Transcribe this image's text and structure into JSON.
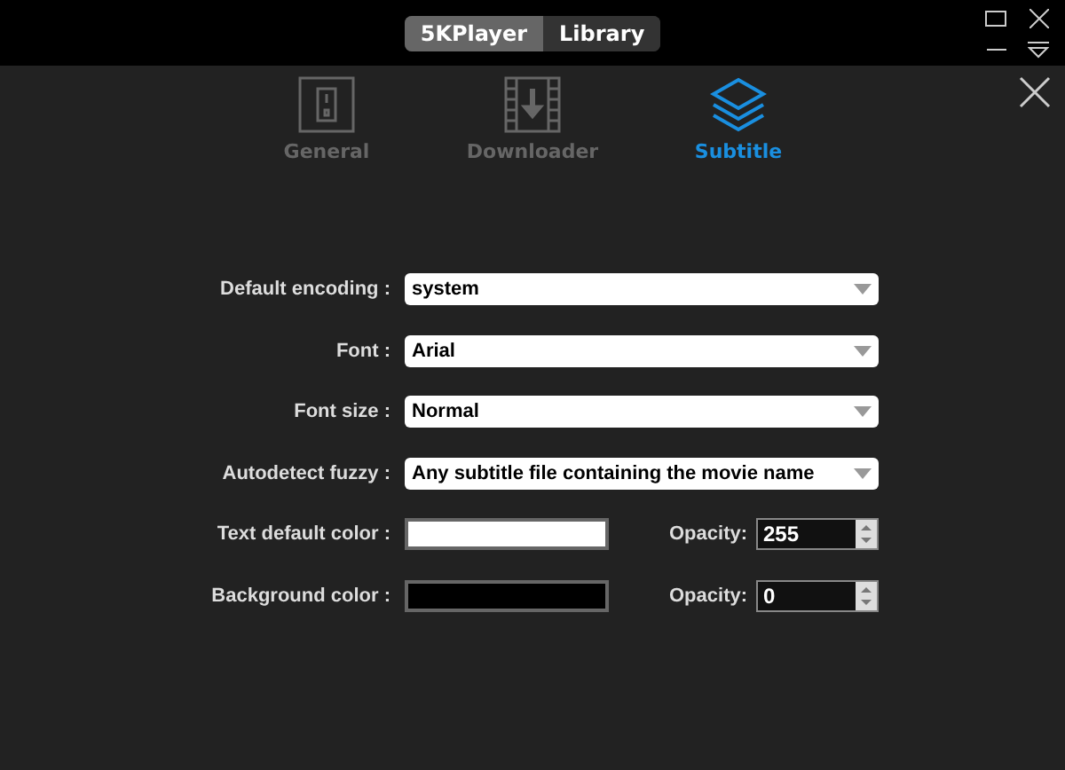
{
  "top_bar": {
    "switch": [
      {
        "label": "5KPlayer",
        "selected": true
      },
      {
        "label": "Library",
        "selected": false
      }
    ]
  },
  "tabs": [
    {
      "label": "General",
      "kind": "switch",
      "selected": false
    },
    {
      "label": "Downloader",
      "kind": "download",
      "selected": false
    },
    {
      "label": "Subtitle",
      "kind": "layers",
      "selected": true
    }
  ],
  "settings": [
    {
      "kind": "dropdown",
      "label": "Default encoding :",
      "value": "system"
    },
    {
      "kind": "dropdown",
      "label": "Font :",
      "value": "Arial"
    },
    {
      "kind": "dropdown",
      "label": "Font size :",
      "value": "Normal"
    },
    {
      "kind": "dropdown",
      "label": "Autodetect fuzzy :",
      "value": "Any subtitle file containing the movie name"
    },
    {
      "kind": "color",
      "label": "Text default color :",
      "color": "#ffffff",
      "opacity_label": "Opacity:",
      "opacity": "255"
    },
    {
      "kind": "color",
      "label": "Background color :",
      "color": "#000000",
      "opacity_label": "Opacity:",
      "opacity": "0"
    }
  ]
}
